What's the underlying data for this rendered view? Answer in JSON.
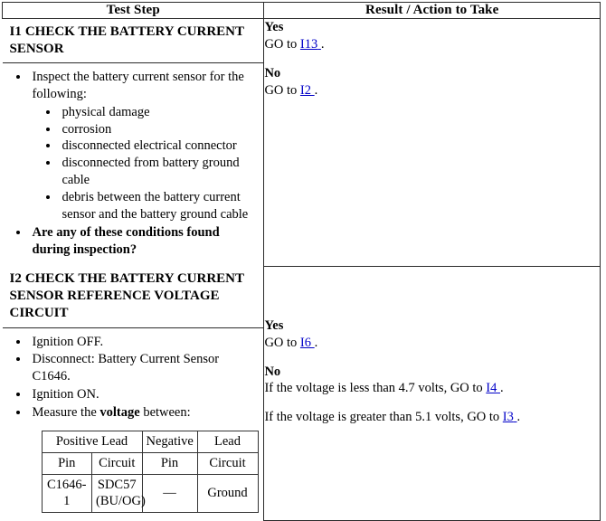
{
  "table": {
    "headers": {
      "test_step": "Test Step",
      "result_action": "Result / Action to Take"
    }
  },
  "steps": [
    {
      "id": "I1",
      "title": "CHECK THE BATTERY CURRENT SENSOR",
      "instructions": {
        "lead_in": "Inspect the battery current sensor for the following:",
        "sub_items": [
          "physical damage",
          "corrosion",
          "disconnected electrical connector",
          "disconnected from battery ground cable",
          "debris between the battery current sensor and the battery ground cable"
        ],
        "question": "Are any of these conditions found during inspection?"
      },
      "result": {
        "yes_label": "Yes",
        "yes_prefix": "GO to ",
        "yes_link": "I13",
        "yes_suffix": ".",
        "no_label": "No",
        "no_prefix": "GO to ",
        "no_link": "I2",
        "no_suffix": "."
      }
    },
    {
      "id": "I2",
      "title": "CHECK THE BATTERY CURRENT SENSOR REFERENCE VOLTAGE CIRCUIT",
      "instructions": {
        "item1": "Ignition OFF.",
        "item2": "Disconnect: Battery Current Sensor C1646.",
        "item3": "Ignition ON.",
        "item4_pre": "Measure the ",
        "item4_bold": "voltage",
        "item4_post": " between:"
      },
      "pin_table": {
        "group_positive": "Positive Lead",
        "group_negative_a": "Negative",
        "group_negative_b": "Lead",
        "col_pin": "Pin",
        "col_circuit": "Circuit",
        "col_npin": "Pin",
        "col_ncircuit": "Circuit",
        "row": {
          "pin": "C1646-1",
          "circuit": "SDC57 (BU/OG)",
          "npin": "—",
          "ncircuit": "Ground"
        }
      },
      "result": {
        "yes_label": "Yes",
        "yes_prefix": "GO to ",
        "yes_link": "I6",
        "yes_suffix": ".",
        "no_label": "No",
        "no_line1_pre": "If the voltage is less than 4.7 volts, GO to ",
        "no_line1_link": "I4",
        "no_line1_post": ".",
        "no_line2_pre": "If the voltage is greater than 5.1 volts, GO to ",
        "no_line2_link": "I3",
        "no_line2_post": "."
      }
    }
  ],
  "colors": {
    "link": "#0000c8",
    "border": "#2b2b2b",
    "text": "#000000",
    "background": "#ffffff"
  }
}
